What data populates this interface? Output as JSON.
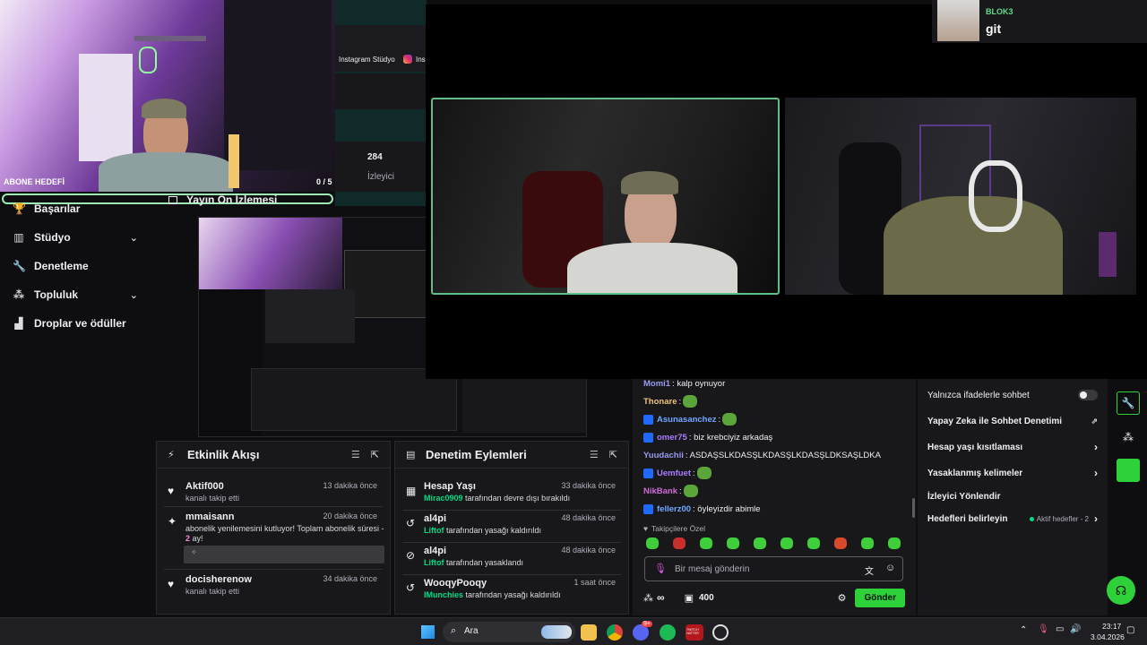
{
  "topbar": {
    "instagram_label": "Instagram Stüdyo",
    "instagram_trunc": "Ins"
  },
  "webcam_overlay": {
    "goal_label": "ABONE HEDEFİ",
    "goal_count": "0 / 5"
  },
  "preview": {
    "label": "Yayın Ön İzlemesi"
  },
  "stats": {
    "viewers_value": "284",
    "viewers_label": "İzleyici",
    "trunc_label": "ın"
  },
  "sidebar": {
    "items": [
      {
        "label": "Başarılar",
        "icon": "trophy-icon",
        "expand": false
      },
      {
        "label": "Stüdyo",
        "icon": "studio-icon",
        "expand": true
      },
      {
        "label": "Denetleme",
        "icon": "wrench-icon",
        "expand": false
      },
      {
        "label": "Topluluk",
        "icon": "community-icon",
        "expand": true
      },
      {
        "label": "Droplar ve ödüller",
        "icon": "drops-icon",
        "expand": false
      }
    ]
  },
  "activity_feed": {
    "title": "Etkinlik Akışı",
    "items": [
      {
        "name": "Aktif000",
        "time": "13 dakika önce",
        "sub": "kanalı takip etti",
        "icon": "heart-icon"
      },
      {
        "name": "mmaisann",
        "time": "20 dakika önce",
        "sub": "abonelik yenilemesini kutluyor! Toplam abonelik süresi - ",
        "sub_value": "2",
        "sub_tail": "ay!",
        "icon": "star-icon"
      },
      {
        "name": "docisherenow",
        "time": "34 dakika önce",
        "sub": "kanalı takip etti",
        "icon": "heart-icon"
      }
    ]
  },
  "mod_actions": {
    "title": "Denetim Eylemleri",
    "items": [
      {
        "name": "Hesap Yaşı",
        "time": "33 dakika önce",
        "actor": "Mirac0909",
        "action": " tarafından devre dışı bırakıldı",
        "icon": "calendar-icon"
      },
      {
        "name": "al4pi",
        "time": "48 dakika önce",
        "actor": "Liftof",
        "action": " tarafından yasağı kaldırıldı",
        "icon": "undo-icon"
      },
      {
        "name": "al4pi",
        "time": "48 dakika önce",
        "actor": "Liftof",
        "action": " tarafından yasaklandı",
        "icon": "ban-icon"
      },
      {
        "name": "WooqyPooqy",
        "time": "1 saat önce",
        "actor": "IMunchies",
        "action": " tarafından yasağı kaldırıldı",
        "icon": "undo-icon"
      }
    ]
  },
  "chat": {
    "messages": [
      {
        "user": "Momi1",
        "text": ": kalp oynuyor",
        "color": "#9a9af0",
        "badge": false,
        "emote": false
      },
      {
        "user": "Thonare",
        "text": ":",
        "color": "#f0c27a",
        "badge": false,
        "emote": true
      },
      {
        "user": "Asunasanchez",
        "text": ":",
        "color": "#6fa8ff",
        "badge": true,
        "emote": true
      },
      {
        "user": "omer75",
        "text": ": biz krebciyiz arkadaş",
        "color": "#a97bff",
        "badge": true,
        "emote": false
      },
      {
        "user": "Yuudachii",
        "text": ": ASDAŞSLKDASŞLKDASŞLKDASŞLDKSAŞLDKA",
        "color": "#9a9af0",
        "badge": false,
        "emote": false
      },
      {
        "user": "Uemfuet",
        "text": ":",
        "color": "#a97bff",
        "badge": true,
        "emote": true
      },
      {
        "user": "NikBank",
        "text": ":",
        "color": "#d06ad8",
        "badge": false,
        "emote": true
      },
      {
        "user": "fellerz00",
        "text": ": öyleyizdir abimle",
        "color": "#6fa8ff",
        "badge": true,
        "emote": false
      }
    ],
    "followers_only": "Takipçilere Özel",
    "input_placeholder": "Bir mesaj gönderin",
    "points": "400",
    "infinity": "∞",
    "send_label": "Gönder"
  },
  "settings": {
    "emote_only": "Yalnızca ifadelerle sohbet",
    "ai_mod": "Yapay Zeka ile Sohbet Denetimi",
    "account_age": "Hesap yaşı kısıtlaması",
    "banned_words": "Yasaklanmış kelimeler",
    "viewer_redirect": "İzleyici Yönlendir",
    "set_goals": "Hedefleri belirleyin",
    "active_goals": "Aktif hedefler - 2"
  },
  "guest": {
    "title": "BLOK3",
    "message": "git"
  },
  "taskbar": {
    "search": "Ara",
    "time": "23:17",
    "date": "3.04.2026",
    "notif_badge": "9+",
    "app_label": "TWITCH HATTER"
  },
  "colors": {
    "accent_green": "#00db84",
    "send_green": "#2ed13a",
    "preview_border": "#9beab4"
  }
}
